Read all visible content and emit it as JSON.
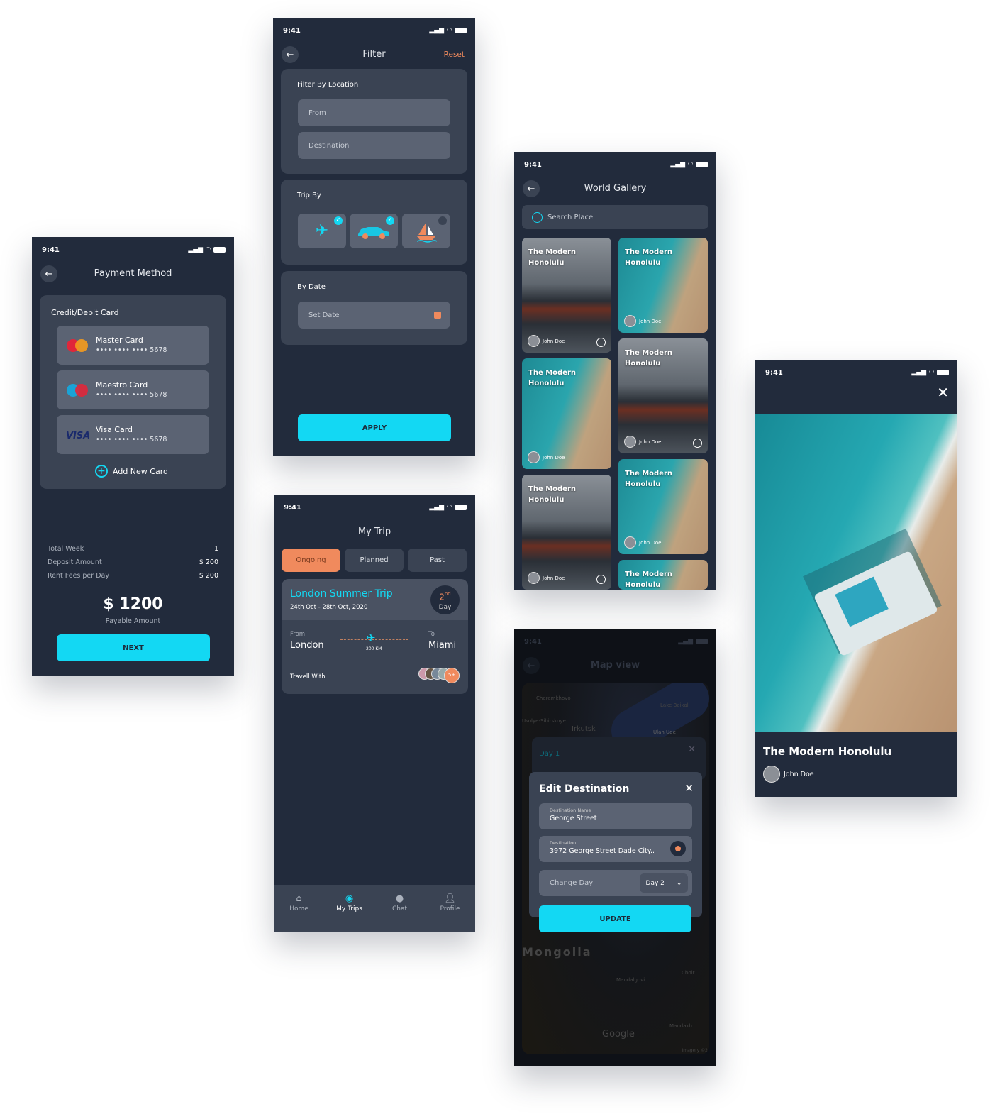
{
  "status_time": "9:41",
  "payment": {
    "title": "Payment Method",
    "section": "Credit/Debit Card",
    "cards": [
      {
        "name": "Master Card",
        "number": "•••• •••• •••• 5678",
        "logo": "mastercard-logo"
      },
      {
        "name": "Maestro Card",
        "number": "•••• •••• •••• 5678",
        "logo": "maestro-logo"
      },
      {
        "name": "Visa Card",
        "number": "•••• •••• •••• 5678",
        "logo": "visa-logo"
      }
    ],
    "add_card": "Add New Card",
    "summary": [
      {
        "label": "Total Week",
        "value": "1"
      },
      {
        "label": "Deposit Amount",
        "value": "$ 200"
      },
      {
        "label": "Rent Fees per Day",
        "value": "$ 200"
      }
    ],
    "total": "$ 1200",
    "total_label": "Payable Amount",
    "next": "NEXT"
  },
  "filter": {
    "title": "Filter",
    "reset": "Reset",
    "location_label": "Filter By Location",
    "from_placeholder": "From",
    "destination_placeholder": "Destination",
    "trip_label": "Trip By",
    "trip_options": [
      {
        "icon": "plane-icon",
        "selected": true
      },
      {
        "icon": "car-icon",
        "selected": true
      },
      {
        "icon": "boat-icon",
        "selected": false
      }
    ],
    "date_label": "By Date",
    "date_placeholder": "Set Date",
    "apply": "APPLY"
  },
  "mytrip": {
    "title": "My Trip",
    "tabs": [
      "Ongoing",
      "Planned",
      "Past"
    ],
    "active_tab": "Ongoing",
    "trip_name": "London Summer Trip",
    "dates": "24th Oct - 28th Oct, 2020",
    "day_num": "2",
    "day_suffix": "nd",
    "day_label": "Day",
    "from_label": "From",
    "from": "London",
    "to_label": "To",
    "to": "Miami",
    "distance": "200 KM",
    "travel_with": "Travell With",
    "more_count": "5+",
    "nav": [
      {
        "label": "Home",
        "icon": "home-icon"
      },
      {
        "label": "My Trips",
        "icon": "compass-icon",
        "active": true
      },
      {
        "label": "Chat",
        "icon": "chat-icon"
      },
      {
        "label": "Profile",
        "icon": "profile-icon"
      }
    ]
  },
  "gallery": {
    "title": "World Gallery",
    "search_placeholder": "Search Place",
    "item_title_1": "The Modern",
    "item_title_2": "Honolulu",
    "author": "John Doe"
  },
  "map": {
    "title": "Map view",
    "labels": [
      "Cheremkhovo",
      "Usolye-Sibirskoye",
      "Irkutsk",
      "Lake Baikal",
      "Ulan Ude",
      "Mongolia",
      "Choir",
      "Mandalgovi",
      "Mandakh",
      "Google",
      "Imagery ©2"
    ],
    "behind_sheet": "Day 1",
    "dialog_title": "Edit Destination",
    "name_label": "Destination Name",
    "name_value": "George Street",
    "dest_label": "Destination",
    "dest_value": "3972 George Street Dade City..",
    "change_day": "Change Day",
    "day_value": "Day 2",
    "update": "UPDATE"
  },
  "detail": {
    "title": "The Modern Honolulu",
    "author": "John Doe"
  },
  "colors": {
    "bg": "#222b3c",
    "panel": "#3a4353",
    "field": "#5b6373",
    "accent": "#13d8f3",
    "orange": "#f08a5d"
  }
}
